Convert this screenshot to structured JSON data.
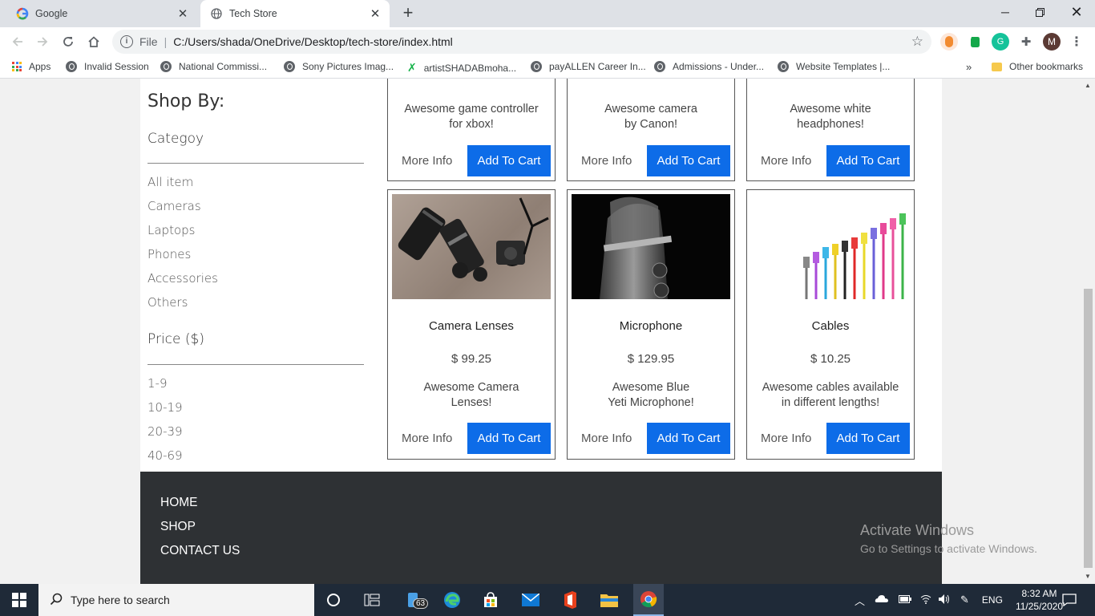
{
  "browser": {
    "tabs": [
      {
        "title": "Google",
        "active": false
      },
      {
        "title": "Tech Store",
        "active": true
      }
    ],
    "url_scheme": "File",
    "url": "C:/Users/shada/OneDrive/Desktop/tech-store/index.html",
    "profile_initial": "M",
    "bookmarks": [
      "Apps",
      "Invalid Session",
      "National Commissi...",
      "Sony Pictures Imag...",
      "artistSHADABmoha...",
      "payALLEN Career In...",
      "Admissions - Under...",
      "Website Templates |..."
    ],
    "overflow": "»",
    "other_bookmarks": "Other bookmarks"
  },
  "sidebar": {
    "heading": "Shop By:",
    "category_heading": "Categoy",
    "categories": [
      "All item",
      "Cameras",
      "Laptops",
      "Phones",
      "Accessories",
      "Others"
    ],
    "price_heading": "Price ($)",
    "prices": [
      "1-9",
      "10-19",
      "20-39",
      "40-69"
    ]
  },
  "top_cards": [
    {
      "desc1": "Awesome game controller",
      "desc2": "for xbox!",
      "more": "More Info",
      "cart": "Add To Cart"
    },
    {
      "desc1": "Awesome camera",
      "desc2": "by Canon!",
      "more": "More Info",
      "cart": "Add To Cart"
    },
    {
      "desc1": "Awesome white",
      "desc2": "headphones!",
      "more": "More Info",
      "cart": "Add To Cart"
    }
  ],
  "products": [
    {
      "name": "Camera Lenses",
      "price": "$ 99.25",
      "desc1": "Awesome Camera",
      "desc2": "Lenses!",
      "more": "More Info",
      "cart": "Add To Cart"
    },
    {
      "name": "Microphone",
      "price": "$ 129.95",
      "desc1": "Awesome Blue",
      "desc2": "Yeti Microphone!",
      "more": "More Info",
      "cart": "Add To Cart"
    },
    {
      "name": "Cables",
      "price": "$ 10.25",
      "desc1": "Awesome cables available",
      "desc2": "in different lengths!",
      "more": "More Info",
      "cart": "Add To Cart"
    }
  ],
  "footer": {
    "links": [
      "HOME",
      "SHOP",
      "CONTACT US"
    ]
  },
  "watermark": {
    "line1": "Activate Windows",
    "line2": "Go to Settings to activate Windows."
  },
  "taskbar": {
    "search_placeholder": "Type here to search",
    "badge": "63",
    "language": "ENG",
    "time": "8:32 AM",
    "date": "11/25/2020"
  },
  "colors": {
    "accent": "#0d6ce8",
    "footer": "#2e3134",
    "taskbar": "#1f2a38"
  }
}
